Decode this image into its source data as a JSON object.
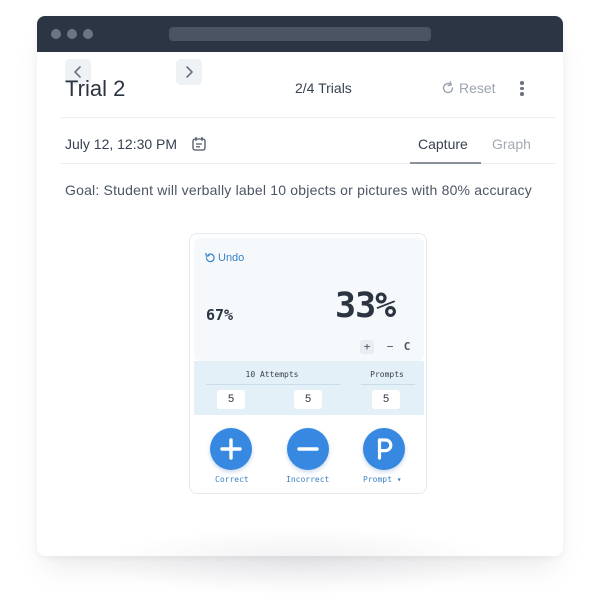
{
  "header": {
    "prev_icon": "chevron-left-icon",
    "next_icon": "chevron-right-icon",
    "trial_title": "Trial 2",
    "trials_count": "2/4 Trials",
    "reset_label": "Reset",
    "reset_icon": "refresh-icon",
    "menu_icon": "more-vertical-icon"
  },
  "session": {
    "date": "July 12, 12:30 PM",
    "calendar_icon": "calendar-icon",
    "tabs": [
      {
        "label": "Capture",
        "active": true
      },
      {
        "label": "Graph",
        "active": false
      }
    ]
  },
  "goal": "Goal: Student will verbally label 10 objects or pictures with 80% accuracy",
  "capture": {
    "undo_label": "Undo",
    "undo_icon": "undo-icon",
    "incorrect_percent": "67%",
    "correct_percent": "33%",
    "adjust_plus": "+",
    "adjust_minus": "−",
    "adjust_clear": "C",
    "attempts_label": "10 Attempts",
    "prompts_label": "Prompts",
    "correct_count": "5",
    "incorrect_count": "5",
    "prompts_count": "5",
    "buttons": [
      {
        "label": "Correct",
        "icon": "plus-icon"
      },
      {
        "label": "Incorrect",
        "icon": "minus-icon"
      },
      {
        "label": "Prompt ▾",
        "icon": "prompt-p-icon"
      }
    ]
  },
  "colors": {
    "titlebar": "#2b3544",
    "accent": "#3688e0",
    "link": "#3b82c6",
    "stats_bg": "#e4f0f8"
  }
}
